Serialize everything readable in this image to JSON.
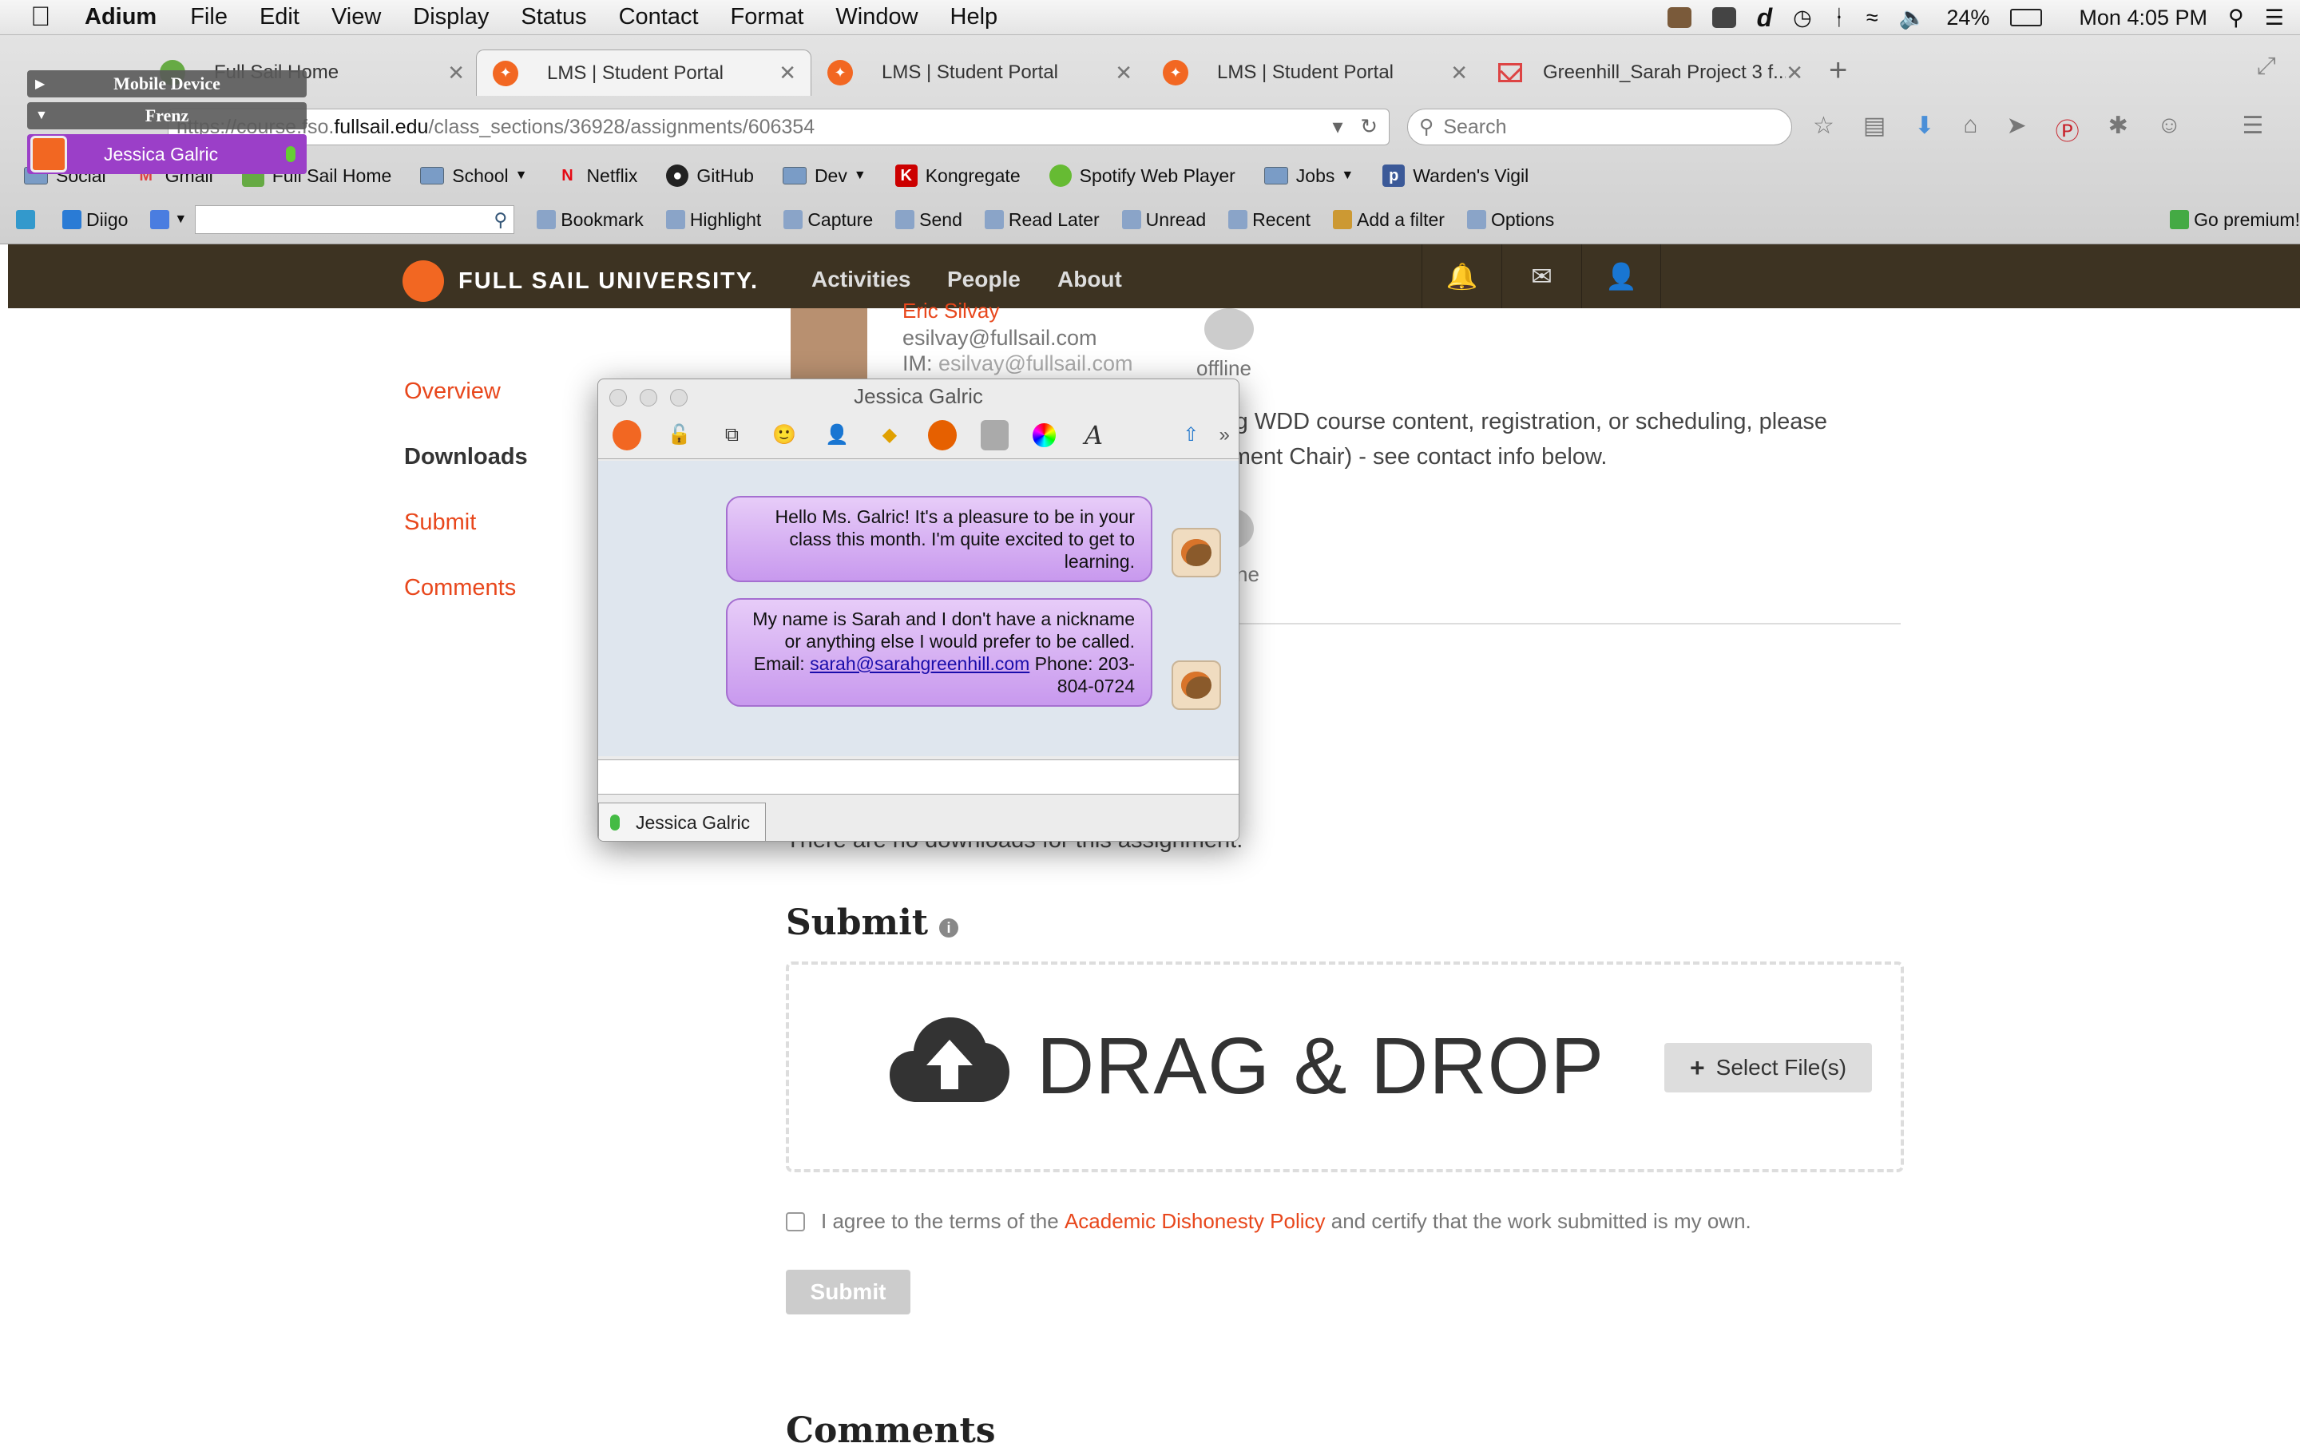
{
  "menubar": {
    "app": "Adium",
    "items": [
      "File",
      "Edit",
      "View",
      "Display",
      "Status",
      "Contact",
      "Format",
      "Window",
      "Help"
    ],
    "battery": "24%",
    "clock": "Mon 4:05 PM"
  },
  "browser": {
    "tabs": [
      {
        "label": "Full Sail Home"
      },
      {
        "label": "LMS | Student Portal"
      },
      {
        "label": "LMS | Student Portal"
      },
      {
        "label": "LMS | Student Portal"
      },
      {
        "label": "Greenhill_Sarah Project 3 f..."
      }
    ],
    "url_prefix": "https://course.fso.",
    "url_domain": "fullsail.edu",
    "url_path": "/class_sections/36928/assignments/606354",
    "search_placeholder": "Search",
    "bookmarks": [
      "Social",
      "Gmail",
      "Full Sail Home",
      "School",
      "Netflix",
      "GitHub",
      "Dev",
      "Kongregate",
      "Spotify Web Player",
      "Jobs",
      "Warden's Vigil"
    ],
    "diigo": [
      "Diigo",
      "Bookmark",
      "Highlight",
      "Capture",
      "Send",
      "Read Later",
      "Unread",
      "Recent",
      "Add a filter",
      "Options",
      "Go premium!"
    ]
  },
  "contact_list": {
    "group1": "Mobile Device",
    "group2": "Frenz",
    "contact": "Jessica Galric"
  },
  "site": {
    "brand": "FULL SAIL UNIVERSITY.",
    "nav": [
      "Activities",
      "People",
      "About"
    ],
    "side": [
      "Overview",
      "Downloads",
      "Submit",
      "Comments"
    ],
    "instructor_name": "Eric Silvay",
    "instructor_email": "esilvay@fullsail.com",
    "instructor_im_label": "IM:",
    "instructor_im": "esilvay@fullsail.com",
    "offline": "offline",
    "offline2": "ne",
    "line1": "ing WDD course content, registration, or scheduling, please",
    "line2": "rtment Chair) - see contact info below.",
    "downloads_note": "There are no downloads for this assignment.",
    "submit_heading": "Submit",
    "drag_drop": "DRAG & DROP",
    "select_files": "Select File(s)",
    "agree_pre": "I agree to the terms of the",
    "agree_link": "Academic Dishonesty Policy",
    "agree_post": "and certify that the work submitted is my own.",
    "submit_button": "Submit",
    "comments_heading": "Comments"
  },
  "chat": {
    "title": "Jessica Galric",
    "msg1": "Hello Ms. Galric! It's a pleasure to be in your class this month. I'm quite excited to get to learning.",
    "msg2_text": "My name is Sarah and I don't have a nickname or anything else I would prefer to be called. Email:",
    "msg2_email": "sarah@sarahgreenhill.com",
    "msg2_phone": "Phone: 203-804-0724",
    "tab_label": "Jessica Galric"
  }
}
